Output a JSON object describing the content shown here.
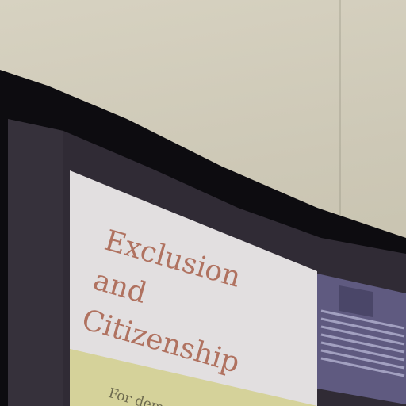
{
  "book_cover": {
    "title_line1": "Exclusion",
    "title_line2": "and",
    "title_line3": "Citizenship",
    "subtitle_fragment": "For dem"
  },
  "colors": {
    "wall": "#cdc8b6",
    "monitor_bezel": "#0d0c10",
    "screen_background": "#302b35",
    "cover_top": "#e2dfe0",
    "cover_band": "#d5d29a",
    "title_text": "#b07260"
  }
}
